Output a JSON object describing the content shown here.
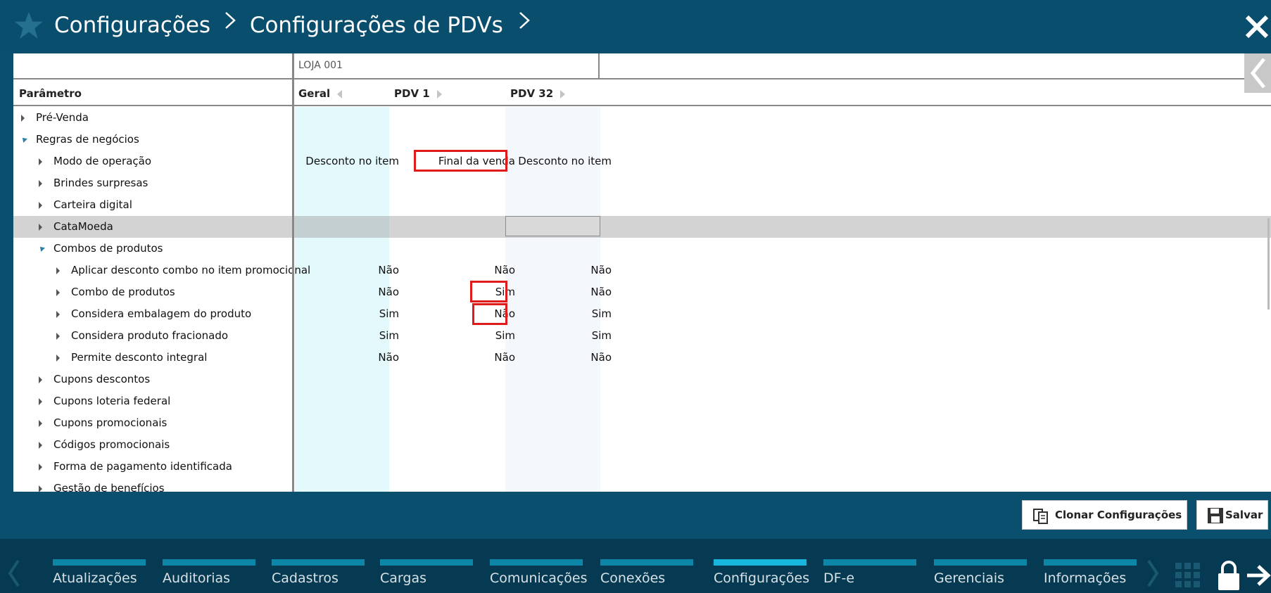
{
  "header": {
    "crumb_1": "Configurações",
    "crumb_2": "Configurações de PDVs"
  },
  "grid": {
    "store_label": "LOJA 001",
    "columns": {
      "param": "Parâmetro",
      "geral": "Geral",
      "pdv1": "PDV 1",
      "pdv32": "PDV 32"
    },
    "rows": [
      {
        "label": "Pré-Venda",
        "level": 0,
        "expanded": false
      },
      {
        "label": "Regras de negócios",
        "level": 0,
        "expanded": true
      },
      {
        "label": "Modo de operação",
        "level": 1,
        "expanded": false,
        "geral": "Desconto no item",
        "pdv1": "Final da venda",
        "pdv32": "Desconto no item"
      },
      {
        "label": "Brindes surpresas",
        "level": 1,
        "expanded": false
      },
      {
        "label": "Carteira digital",
        "level": 1,
        "expanded": false
      },
      {
        "label": "CataMoeda",
        "level": 1,
        "expanded": false,
        "selected": true
      },
      {
        "label": "Combos de produtos",
        "level": 1,
        "expanded": true
      },
      {
        "label": "Aplicar desconto combo no item promocional",
        "level": 2,
        "expanded": false,
        "geral": "Não",
        "pdv1": "Não",
        "pdv32": "Não"
      },
      {
        "label": "Combo de produtos",
        "level": 2,
        "expanded": false,
        "geral": "Não",
        "pdv1": "Sim",
        "pdv32": "Não"
      },
      {
        "label": "Considera embalagem do produto",
        "level": 2,
        "expanded": false,
        "geral": "Sim",
        "pdv1": "Não",
        "pdv32": "Sim"
      },
      {
        "label": "Considera produto fracionado",
        "level": 2,
        "expanded": false,
        "geral": "Sim",
        "pdv1": "Sim",
        "pdv32": "Sim"
      },
      {
        "label": "Permite desconto integral",
        "level": 2,
        "expanded": false,
        "geral": "Não",
        "pdv1": "Não",
        "pdv32": "Não"
      },
      {
        "label": "Cupons descontos",
        "level": 1,
        "expanded": false
      },
      {
        "label": "Cupons loteria federal",
        "level": 1,
        "expanded": false
      },
      {
        "label": "Cupons promocionais",
        "level": 1,
        "expanded": false
      },
      {
        "label": "Códigos promocionais",
        "level": 1,
        "expanded": false
      },
      {
        "label": "Forma de pagamento identificada",
        "level": 1,
        "expanded": false
      },
      {
        "label": "Gestão de benefícios",
        "level": 1,
        "expanded": false
      }
    ]
  },
  "actions": {
    "clone_label": "Clonar Configurações",
    "save_label": "Salvar"
  },
  "nav": {
    "active_index": 6,
    "tabs": [
      "Atualizações",
      "Auditorias",
      "Cadastros",
      "Cargas",
      "Comunicações",
      "Conexões",
      "Configurações",
      "DF-e",
      "Gerenciais",
      "Informações"
    ]
  },
  "colors": {
    "header_bg": "#0a4e6e",
    "nav_bg": "#063a52",
    "tab_bar": "#0e86a8",
    "tab_bar_active": "#17b6dc",
    "highlight": "#e01b1b",
    "geral_column": "#e3f9fb"
  },
  "icons": {
    "favorite": "star-icon",
    "close": "close-icon",
    "clone": "clone-icon",
    "save": "floppy-disk-icon",
    "menu_grid": "grid-icon",
    "lock": "lock-icon",
    "exit": "exit-arrow-icon"
  }
}
